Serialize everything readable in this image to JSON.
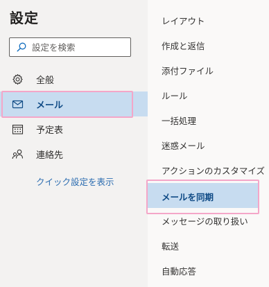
{
  "settings": {
    "title": "設定"
  },
  "search": {
    "placeholder": "設定を検索"
  },
  "nav": {
    "items": [
      {
        "label": "全般",
        "icon": "gear-icon"
      },
      {
        "label": "メール",
        "icon": "mail-icon",
        "selected": true
      },
      {
        "label": "予定表",
        "icon": "calendar-icon"
      },
      {
        "label": "連絡先",
        "icon": "people-icon"
      }
    ],
    "quick_link": "クイック設定を表示"
  },
  "mail_settings": {
    "items": [
      {
        "label": "レイアウト"
      },
      {
        "label": "作成と返信"
      },
      {
        "label": "添付ファイル"
      },
      {
        "label": "ルール"
      },
      {
        "label": "一括処理"
      },
      {
        "label": "迷惑メール"
      },
      {
        "label": "アクションのカスタマイズ"
      },
      {
        "label": "メールを同期",
        "selected": true
      },
      {
        "label": "メッセージの取り扱い"
      },
      {
        "label": "転送"
      },
      {
        "label": "自動応答"
      }
    ]
  },
  "colors": {
    "selected_background": "#c7dcf0",
    "selected_text": "#0f4a85",
    "highlight_border": "#f4a6c8",
    "link": "#2b6cb0"
  }
}
